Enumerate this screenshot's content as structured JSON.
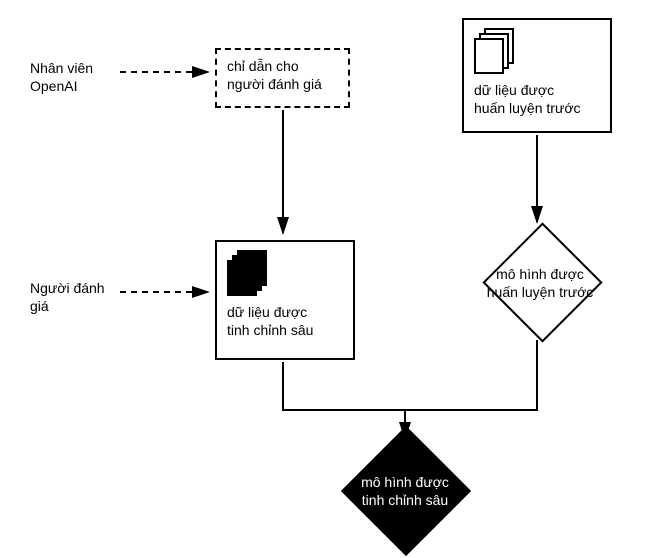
{
  "labels": {
    "openai_staff": "Nhân viên\nOpenAI",
    "reviewers": "Người đánh\ngiá"
  },
  "nodes": {
    "instructions": "chỉ dẫn cho\nngười đánh giá",
    "pretrain_data": "dữ liệu được\nhuấn luyện trước",
    "finetune_data": "dữ liệu được\ntinh chỉnh sâu",
    "pretrain_model": "mô hình được\nhuấn luyện trước",
    "finetune_model": "mô hình được\ntinh chỉnh sâu"
  }
}
